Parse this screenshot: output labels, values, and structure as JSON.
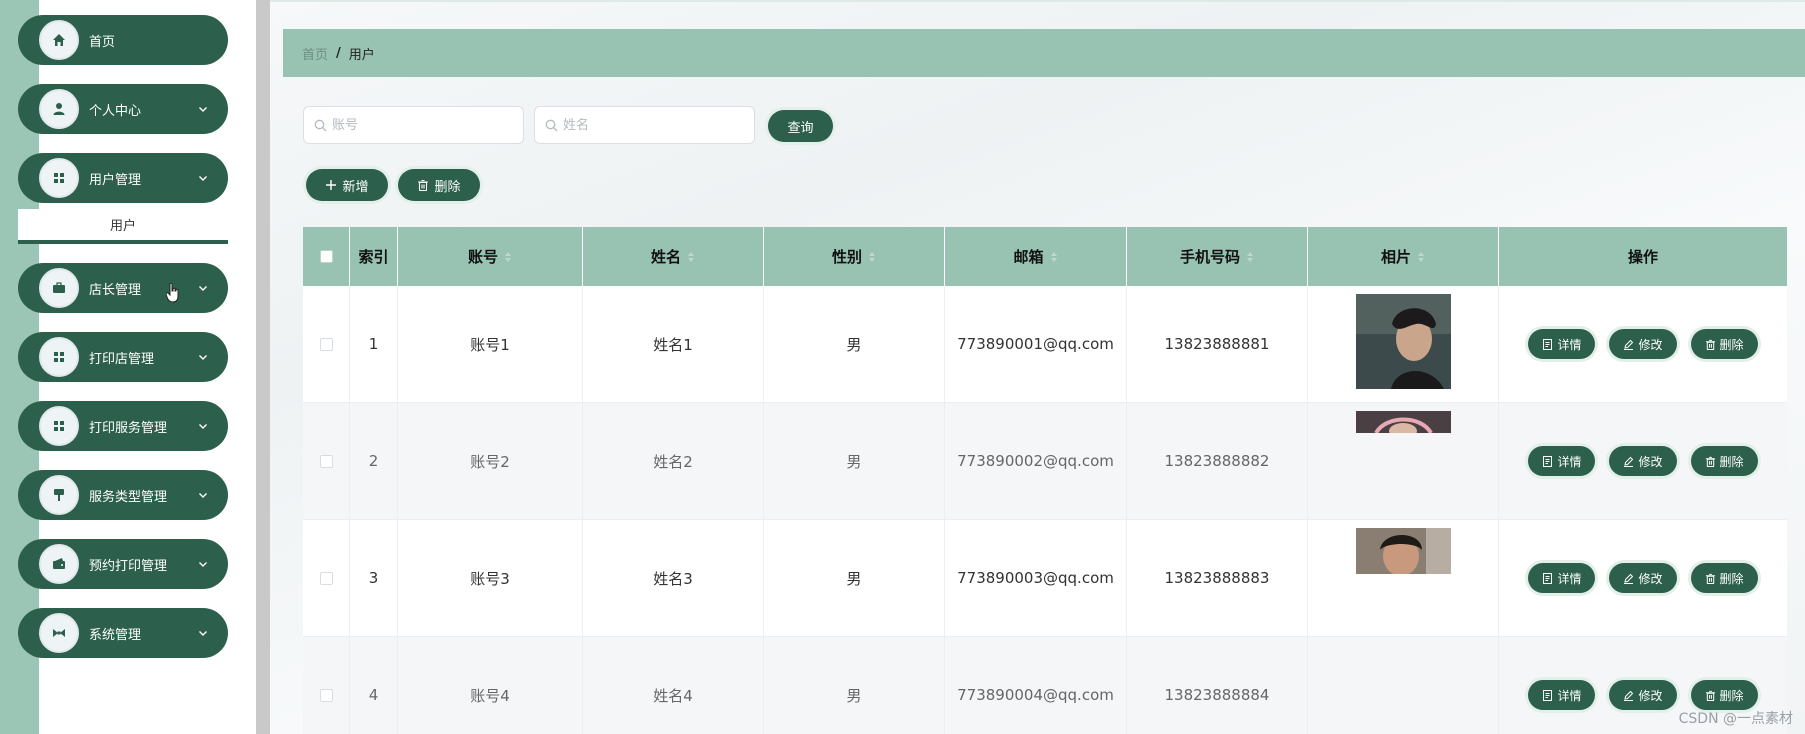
{
  "sidebar": {
    "items": [
      {
        "label": "首页",
        "icon": "home-icon",
        "has_arrow": false
      },
      {
        "label": "个人中心",
        "icon": "user-icon",
        "has_arrow": true
      },
      {
        "label": "用户管理",
        "icon": "grid-icon",
        "has_arrow": true
      },
      {
        "label": "店长管理",
        "icon": "briefcase-icon",
        "has_arrow": true
      },
      {
        "label": "打印店管理",
        "icon": "grid-icon",
        "has_arrow": true
      },
      {
        "label": "打印服务管理",
        "icon": "grid-icon",
        "has_arrow": true
      },
      {
        "label": "服务类型管理",
        "icon": "brush-icon",
        "has_arrow": true
      },
      {
        "label": "预约打印管理",
        "icon": "wallet-icon",
        "has_arrow": true
      },
      {
        "label": "系统管理",
        "icon": "bowtie-icon",
        "has_arrow": true
      }
    ],
    "submenu_label": "用户"
  },
  "breadcrumb": {
    "home": "首页",
    "separator": "/",
    "current": "用户"
  },
  "search": {
    "account_placeholder": "账号",
    "name_placeholder": "姓名",
    "query_label": "查询"
  },
  "toolbar": {
    "add_label": "新增",
    "delete_label": "删除"
  },
  "table": {
    "columns": [
      "索引",
      "账号",
      "姓名",
      "性别",
      "邮箱",
      "手机号码",
      "相片",
      "操作"
    ],
    "rows": [
      {
        "index": "1",
        "account": "账号1",
        "name": "姓名1",
        "gender": "男",
        "email": "773890001@qq.com",
        "phone": "13823888881"
      },
      {
        "index": "2",
        "account": "账号2",
        "name": "姓名2",
        "gender": "男",
        "email": "773890002@qq.com",
        "phone": "13823888882"
      },
      {
        "index": "3",
        "account": "账号3",
        "name": "姓名3",
        "gender": "男",
        "email": "773890003@qq.com",
        "phone": "13823888883"
      },
      {
        "index": "4",
        "account": "账号4",
        "name": "姓名4",
        "gender": "男",
        "email": "773890004@qq.com",
        "phone": "13823888884"
      }
    ],
    "actions": {
      "detail": "详情",
      "edit": "修改",
      "delete": "删除"
    }
  },
  "watermark": "CSDN @一点素材",
  "colors": {
    "primary": "#2c5f4c",
    "header_bg": "#98c3b3",
    "sidebar_strip": "#9bc5b5"
  }
}
